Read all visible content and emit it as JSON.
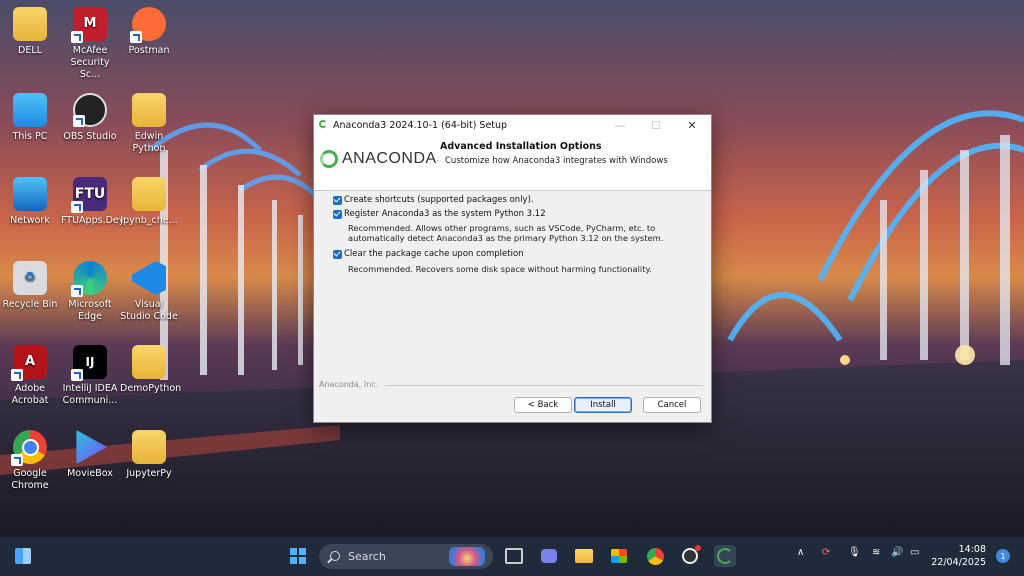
{
  "desktop": {
    "icons": [
      {
        "label": "DELL"
      },
      {
        "label": "McAfee Security Sc..."
      },
      {
        "label": "Postman"
      },
      {
        "label": "This PC"
      },
      {
        "label": "OBS Studio"
      },
      {
        "label": "Edwin Python"
      },
      {
        "label": "Network"
      },
      {
        "label": "FTUApps.Dev"
      },
      {
        "label": "Jpynb_che..."
      },
      {
        "label": "Recycle Bin"
      },
      {
        "label": "Microsoft Edge"
      },
      {
        "label": "Visual Studio Code"
      },
      {
        "label": "Adobe Acrobat"
      },
      {
        "label": "IntelliJ IDEA Communi..."
      },
      {
        "label": "DemoPython"
      },
      {
        "label": "Google Chrome"
      },
      {
        "label": "MovieBox"
      },
      {
        "label": "JupyterPy"
      }
    ],
    "ftu_glyph": "FTU",
    "ij_glyph": "IJ"
  },
  "dialog": {
    "title": "Anaconda3 2024.10-1 (64-bit) Setup",
    "brand": "ANACONDA",
    "brand_mark": ".",
    "header_title": "Advanced Installation Options",
    "header_subtitle": "Customize how Anaconda3 integrates with Windows",
    "options": [
      {
        "label": "Create shortcuts (supported packages only).",
        "checked": true
      },
      {
        "label": "Register Anaconda3 as the system Python 3.12",
        "checked": true,
        "desc1": "Recommended. Allows other programs, such as VSCode, PyCharm, etc. to",
        "desc2": "automatically detect Anaconda3 as the primary Python 3.12 on the system."
      },
      {
        "label": "Clear the package cache upon completion",
        "checked": true,
        "desc1": "Recommended. Recovers some disk space without harming functionality."
      }
    ],
    "footer_brand": "Anaconda, Inc.",
    "buttons": {
      "back": "< Back",
      "install": "Install",
      "cancel": "Cancel"
    },
    "accent_color": "#43b049"
  },
  "taskbar": {
    "search_placeholder": "Search",
    "time": "14:08",
    "date": "22/04/2025",
    "notification_count": "1"
  }
}
